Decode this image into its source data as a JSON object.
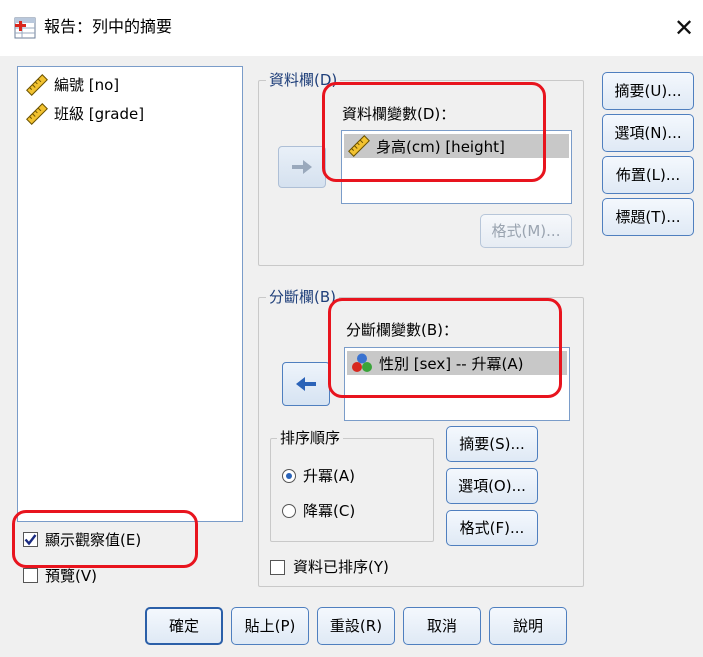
{
  "window": {
    "title": "報告：列中的摘要",
    "close_glyph": "✕"
  },
  "variable_list": {
    "items": [
      {
        "label": "編號 [no]"
      },
      {
        "label": "班級 [grade]"
      }
    ]
  },
  "data_columns": {
    "group_label": "資料欄(D)",
    "variables_label": "資料欄變數(D)：",
    "selected_variable": "身高(cm) [height]",
    "format_button": "格式(M)..."
  },
  "break_columns": {
    "group_label": "分斷欄(B)",
    "variables_label": "分斷欄變數(B)：",
    "selected_variable": "性別 [sex] -- 升冪(A)"
  },
  "sort_order": {
    "group_label": "排序順序",
    "ascending": "升冪(A)",
    "descending": "降冪(C)",
    "selected": "ascending"
  },
  "break_buttons": {
    "summary": "摘要(S)...",
    "options": "選項(O)...",
    "format": "格式(F)..."
  },
  "side_buttons": {
    "summary": "摘要(U)...",
    "options": "選項(N)...",
    "layout": "佈置(L)...",
    "titles": "標題(T)..."
  },
  "checkboxes": {
    "show_cases": {
      "label": "顯示觀察值(E)",
      "checked": true
    },
    "preview": {
      "label": "預覽(V)",
      "checked": false
    },
    "data_sorted": {
      "label": "資料已排序(Y)",
      "checked": false
    }
  },
  "footer": {
    "ok": "確定",
    "paste": "貼上(P)",
    "reset": "重設(R)",
    "cancel": "取消",
    "help": "說明"
  },
  "colors": {
    "annotation_red": "#e8141e",
    "accent_blue": "#2b5fa8"
  }
}
